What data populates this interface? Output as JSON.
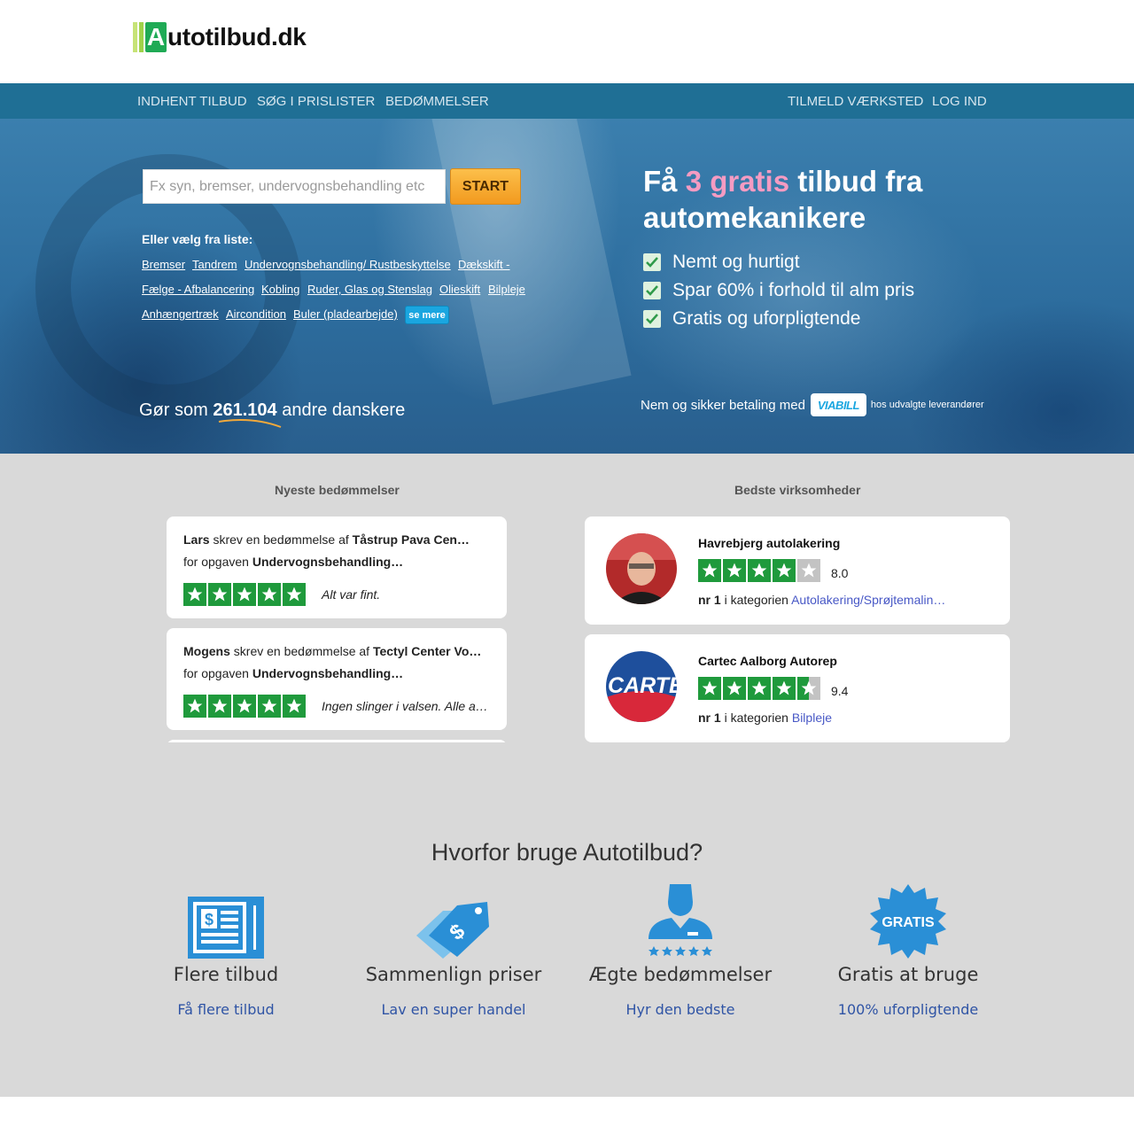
{
  "logo": {
    "letter": "A",
    "text": "utotilbud.dk"
  },
  "nav": {
    "left": [
      "INDHENT TILBUD",
      "SØG I PRISLISTER",
      "BEDØMMELSER"
    ],
    "right": [
      "TILMELD VÆRKSTED",
      "LOG IND"
    ]
  },
  "search": {
    "placeholder": "Fx syn, bremser, undervognsbehandling etc",
    "value": "",
    "button": "START"
  },
  "categories": {
    "label": "Eller vælg fra liste:",
    "items": [
      "Bremser",
      "Tandrem",
      "Undervognsbehandling/ Rustbeskyttelse",
      "Dækskift -",
      "Fælge - Afbalancering",
      "Kobling",
      "Ruder, Glas og Stenslag",
      "Olieskift",
      "Bilpleje",
      "Anhængertræk",
      "Aircondition",
      "Buler (pladearbejde)"
    ],
    "more": "se mere"
  },
  "counter": {
    "prefix": "Gør som",
    "number": "261.104",
    "suffix": "andre danskere"
  },
  "hero": {
    "title_pre": "Få",
    "title_highlight": "3 gratis",
    "title_post": "tilbud fra automekanikere",
    "benefits": [
      "Nemt og hurtigt",
      "Spar 60% i forhold til alm pris",
      "Gratis og uforpligtende"
    ],
    "payment_text": "Nem og sikker betaling med",
    "payment_logo": "VIABILL",
    "payment_small": "hos udvalgte leverandører"
  },
  "reviews": {
    "heading": "Nyeste bedømmelser",
    "wrote_text": "skrev en bedømmelse af",
    "task_text": "for opgaven",
    "items": [
      {
        "name": "Lars",
        "company": "Tåstrup Pava Cen…",
        "task": "Undervognsbehandling…",
        "rating": 5,
        "comment": "Alt var fint."
      },
      {
        "name": "Mogens",
        "company": "Tectyl Center Vo…",
        "task": "Undervognsbehandling…",
        "rating": 5,
        "comment": "Ingen slinger i valsen. Alle a…"
      }
    ]
  },
  "businesses": {
    "heading": "Bedste virksomheder",
    "rank_prefix": "nr",
    "rank_mid": "i kategorien",
    "items": [
      {
        "name": "Havrebjerg autolakering",
        "rating_stars": 4,
        "score": "8.0",
        "rank": "1",
        "category": "Autolakering/Sprøjtemalin…",
        "avatar": "person-photo"
      },
      {
        "name": "Cartec Aalborg Autorep",
        "rating_stars": 4.5,
        "score": "9.4",
        "rank": "1",
        "category": "Bilpleje",
        "avatar": "cartec-logo",
        "avatar_text": "CARTE"
      }
    ]
  },
  "why": {
    "title": "Hvorfor bruge Autotilbud?",
    "features": [
      {
        "icon": "document-dollar-icon",
        "title": "Flere tilbud",
        "link": "Få flere tilbud"
      },
      {
        "icon": "price-tag-icon",
        "title": "Sammenlign priser",
        "link": "Lav en super handel"
      },
      {
        "icon": "user-rating-icon",
        "title": "Ægte bedømmelser",
        "link": "Hyr den bedste"
      },
      {
        "icon": "gratis-badge-icon",
        "title": "Gratis at bruge",
        "link": "100% uforpligtende",
        "badge_text": "GRATIS"
      }
    ]
  },
  "colors": {
    "nav_bg": "#1f6f95",
    "start_button": "#f5a623",
    "highlight_pink": "#f59bc2",
    "star_green": "#1f9a3c",
    "link_blue": "#2f54a5",
    "icon_blue": "#2a8fd6"
  }
}
